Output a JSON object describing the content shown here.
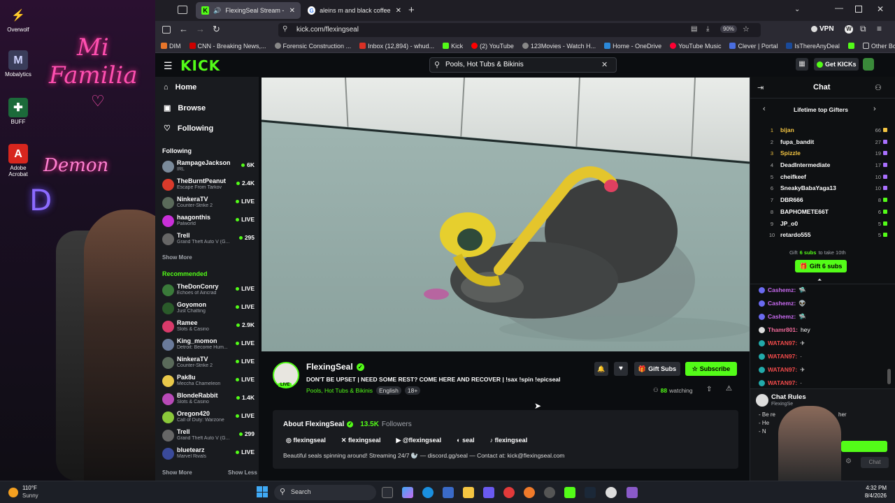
{
  "desktop": {
    "icons": [
      {
        "label": "Overwolf",
        "icon": "overwolf-icon",
        "color": "#c83232"
      },
      {
        "label": "Mobalytics",
        "icon": "mobalytics-icon",
        "color": "#5b5f8a"
      },
      {
        "label": "BUFF",
        "icon": "buff-icon",
        "color": "#27ae60"
      },
      {
        "label": "Adobe Acrobat",
        "icon": "acrobat-icon",
        "color": "#d7261e"
      }
    ],
    "neon_line1": "Mi",
    "neon_line2": "Familia",
    "neon_line3": "Demon",
    "neon_line4": "D"
  },
  "browser": {
    "tabs": [
      {
        "label": "FlexingSeal Stream - Watch",
        "active": true
      },
      {
        "label": "aleins m and black coffee - Goo",
        "active": false
      }
    ],
    "url": "kick.com/flexingseal",
    "vpn_label": "VPN",
    "zoom": "90%",
    "bookmarks": [
      "DIM",
      "CNN - Breaking News,...",
      "Forensic Construction ...",
      "Inbox (12,894) - whud...",
      "Kick",
      "(2) YouTube",
      "123Movies - Watch H...",
      "Home - OneDrive",
      "YouTube Music",
      "Clever | Portal",
      "IsThereAnyDeal"
    ],
    "other_bookmarks": "Other Bookmarks"
  },
  "kick": {
    "logo": "KICK",
    "search_value": "Pools, Hot Tubs & Bikinis",
    "get_kicks": "Get KICKs",
    "nav": [
      {
        "label": "Home",
        "icon": "home-icon"
      },
      {
        "label": "Browse",
        "icon": "browse-icon"
      },
      {
        "label": "Following",
        "icon": "heart-icon"
      }
    ],
    "following_title": "Following",
    "following": [
      {
        "name": "RampageJackson",
        "game": "IRL",
        "viewers": "6K",
        "color": "#7a8a9a"
      },
      {
        "name": "TheBurntPeanut",
        "game": "Escape From Tarkov",
        "viewers": "2.4K",
        "color": "#d93a2b"
      },
      {
        "name": "NinkeraTV",
        "game": "Counter-Strike 2",
        "viewers": "LIVE",
        "color": "#5a6a5a"
      },
      {
        "name": "haagonthis",
        "game": "Palworld",
        "viewers": "LIVE",
        "color": "#c82fd8"
      },
      {
        "name": "Trell",
        "game": "Grand Theft Auto V (G...",
        "viewers": "295",
        "color": "#666666"
      }
    ],
    "show_more_1": "Show More",
    "recommended_title": "Recommended",
    "recommended": [
      {
        "name": "TheDonConry",
        "game": "Echoes of Aincrad",
        "viewers": "LIVE",
        "color": "#3a7a3a"
      },
      {
        "name": "Goyomon",
        "game": "Just Chatting",
        "viewers": "LIVE",
        "color": "#2a5a2a"
      },
      {
        "name": "Ramee",
        "game": "Slots & Casino",
        "viewers": "2.9K",
        "color": "#d83a6a"
      },
      {
        "name": "King_momon",
        "game": "Detroit: Become Hum...",
        "viewers": "LIVE",
        "color": "#6a7a9a"
      },
      {
        "name": "NinkeraTV",
        "game": "Counter-Strike 2",
        "viewers": "LIVE",
        "color": "#5a6a5a"
      },
      {
        "name": "Pak8u",
        "game": "Meccha Chameleon",
        "viewers": "LIVE",
        "color": "#e8c84a"
      },
      {
        "name": "BlondeRabbit",
        "game": "Slots & Casino",
        "viewers": "1.4K",
        "color": "#b84ab8"
      },
      {
        "name": "Oregon420",
        "game": "Call of Duty: Warzone",
        "viewers": "LIVE",
        "color": "#8ac83a"
      },
      {
        "name": "Trell",
        "game": "Grand Theft Auto V (G...",
        "viewers": "299",
        "color": "#666666"
      },
      {
        "name": "bluetearz",
        "game": "Marvel Rivals",
        "viewers": "LIVE",
        "color": "#3a4a9a"
      }
    ],
    "show_more_2": "Show More",
    "show_less": "Show Less",
    "streamer": {
      "name": "FlexingSeal",
      "live_badge": "LIVE",
      "title": "DON'T BE UPSET | NEED SOME REST? COME HERE AND RECOVER | !sax !spin !epicseal",
      "category": "Pools, Hot Tubs & Bikinis",
      "tag1": "English",
      "tag2": "18+",
      "gift_subs": "Gift Subs",
      "subscribe": "Subscribe",
      "watching_count": "88",
      "watching_label": "watching",
      "about_label": "About FlexingSeal",
      "followers_count": "13.5K",
      "followers_label": "Followers",
      "socials": [
        {
          "icon": "instagram-icon",
          "label": "flexingseal"
        },
        {
          "icon": "x-icon",
          "label": "flexingseal"
        },
        {
          "icon": "youtube-icon",
          "label": "@flexingseal"
        },
        {
          "icon": "discord-icon",
          "label": "seal"
        },
        {
          "icon": "tiktok-icon",
          "label": "flexingseal"
        }
      ],
      "bio": "Beautiful seals spinning around! Streaming 24/7 🦭 — discord.gg/seal — Contact at: kick@flexingseal.com"
    },
    "chat": {
      "title": "Chat",
      "gifters_title": "Lifetime top Gifters",
      "gifters": [
        {
          "rank": "1",
          "name": "bijan",
          "count": "66",
          "color": "#f4c542"
        },
        {
          "rank": "2",
          "name": "fupa_bandit",
          "count": "27",
          "color": "#ffffff"
        },
        {
          "rank": "3",
          "name": "Spizzle",
          "count": "19",
          "color": "#f4c542"
        },
        {
          "rank": "4",
          "name": "DeadIntermediate",
          "count": "17",
          "color": "#ffffff"
        },
        {
          "rank": "5",
          "name": "cheifkeef",
          "count": "10",
          "color": "#ffffff"
        },
        {
          "rank": "6",
          "name": "SneakyBabaYaga13",
          "count": "10",
          "color": "#ffffff"
        },
        {
          "rank": "7",
          "name": "DBR666",
          "count": "8",
          "color": "#ffffff"
        },
        {
          "rank": "8",
          "name": "BAPHOMETE66T",
          "count": "6",
          "color": "#ffffff"
        },
        {
          "rank": "9",
          "name": "JP_o0",
          "count": "5",
          "color": "#ffffff"
        },
        {
          "rank": "10",
          "name": "retardo555",
          "count": "5",
          "color": "#ffffff"
        }
      ],
      "gift_prompt_pre": "Gift",
      "gift_prompt_subs": "6 subs",
      "gift_prompt_post": "to take 10th",
      "gift_button": "Gift 6 subs",
      "messages": [
        {
          "user": "Cashemz:",
          "text": "",
          "color": "#c86af0"
        },
        {
          "user": "Cashemz:",
          "text": "",
          "color": "#c86af0"
        },
        {
          "user": "Cashemz:",
          "text": "",
          "color": "#c86af0"
        },
        {
          "user": "Thamr801:",
          "text": "hey",
          "color": "#f06a9a"
        },
        {
          "user": "WATAN97:",
          "text": "",
          "color": "#f04a4a"
        },
        {
          "user": "WATAN97:",
          "text": "",
          "color": "#f04a4a"
        },
        {
          "user": "WATAN97:",
          "text": "",
          "color": "#f04a4a"
        },
        {
          "user": "WATAN97:",
          "text": "",
          "color": "#f04a4a"
        }
      ],
      "rules_title": "Chat Rules",
      "rules_sub": "FlexingSe",
      "rules_lines": [
        "- Be re",
        "- He",
        "- N"
      ],
      "rules_tail": "her",
      "chat_button": "Chat"
    }
  },
  "taskbar": {
    "weather_temp": "110°F",
    "weather_desc": "Sunny",
    "search_placeholder": "Search",
    "time": "4:32 PM",
    "date": "8/4/2026"
  }
}
